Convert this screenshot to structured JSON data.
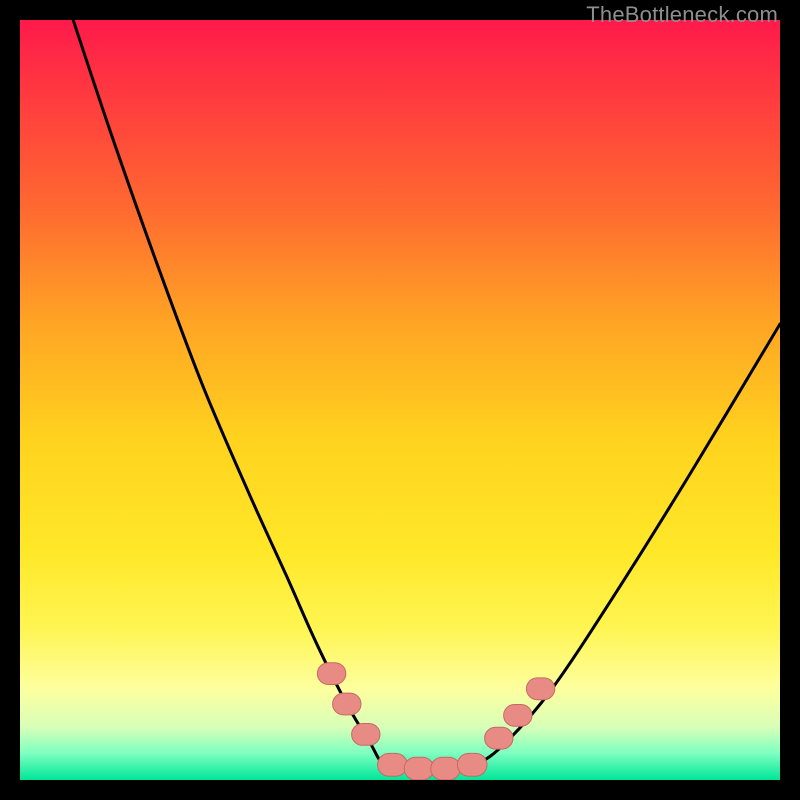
{
  "watermark": "TheBottleneck.com",
  "colors": {
    "frame": "#000000",
    "curve": "#000000",
    "marker_fill": "#e98b85",
    "marker_stroke": "#c46a65",
    "gradient_stops": [
      {
        "offset": 0.0,
        "color": "#ff1a4b"
      },
      {
        "offset": 0.1,
        "color": "#ff3a3f"
      },
      {
        "offset": 0.25,
        "color": "#ff6a30"
      },
      {
        "offset": 0.4,
        "color": "#ffa524"
      },
      {
        "offset": 0.55,
        "color": "#ffd21e"
      },
      {
        "offset": 0.7,
        "color": "#ffe829"
      },
      {
        "offset": 0.8,
        "color": "#fff552"
      },
      {
        "offset": 0.88,
        "color": "#fdff9e"
      },
      {
        "offset": 0.93,
        "color": "#d8ffb8"
      },
      {
        "offset": 0.965,
        "color": "#7dffc0"
      },
      {
        "offset": 1.0,
        "color": "#00e69a"
      }
    ]
  },
  "chart_data": {
    "type": "line",
    "title": "",
    "xlabel": "",
    "ylabel": "",
    "xlim": [
      0,
      100
    ],
    "ylim": [
      0,
      100
    ],
    "note": "V-shaped curve on a vertical red→yellow→green gradient. x is normalized horizontal position (0–100), y is normalized height (0=bottom, 100=top). Left branch falls steeply from top-left to a flat trough near the bottom around x≈48–60, right branch rises more gently toward the upper-right corner. Salmon rounded markers sit on the curve near the trough and at the green band.",
    "series": [
      {
        "name": "curve",
        "x": [
          7,
          12,
          18,
          24,
          30,
          35,
          39,
          43,
          46,
          48,
          52,
          56,
          60,
          64,
          70,
          78,
          88,
          100
        ],
        "y": [
          100,
          85,
          68,
          52,
          38,
          27,
          18,
          10,
          5,
          2,
          1,
          1,
          2,
          5,
          12,
          24,
          40,
          60
        ]
      }
    ],
    "markers": [
      {
        "x": 41.0,
        "y": 14.0,
        "size": 2.3
      },
      {
        "x": 43.0,
        "y": 10.0,
        "size": 2.3
      },
      {
        "x": 45.5,
        "y": 6.0,
        "size": 2.3
      },
      {
        "x": 49.0,
        "y": 2.0,
        "size": 2.4
      },
      {
        "x": 52.5,
        "y": 1.5,
        "size": 2.4
      },
      {
        "x": 56.0,
        "y": 1.5,
        "size": 2.4
      },
      {
        "x": 59.5,
        "y": 2.0,
        "size": 2.4
      },
      {
        "x": 63.0,
        "y": 5.5,
        "size": 2.3
      },
      {
        "x": 65.5,
        "y": 8.5,
        "size": 2.3
      },
      {
        "x": 68.5,
        "y": 12.0,
        "size": 2.3
      }
    ]
  }
}
